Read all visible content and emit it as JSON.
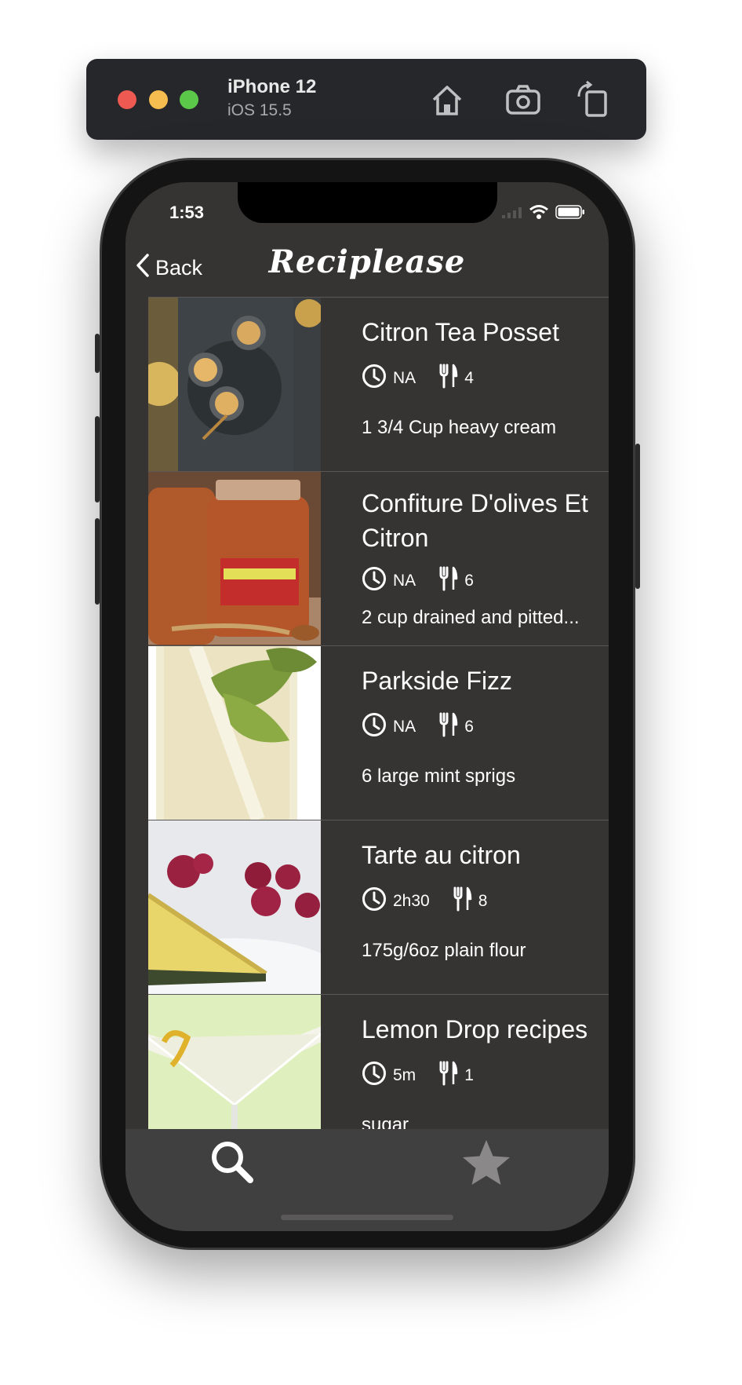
{
  "simulator": {
    "device_name": "iPhone 12",
    "os_version": "iOS 15.5",
    "tools": [
      "home-icon",
      "screenshot-icon",
      "rotate-icon"
    ]
  },
  "status_bar": {
    "time": "1:53",
    "icons": [
      "signal-icon",
      "wifi-icon",
      "battery-icon"
    ]
  },
  "nav": {
    "back_label": "Back",
    "title": "Reciplease"
  },
  "recipes": [
    {
      "title": "Citron Tea Posset",
      "time": "NA",
      "servings": "4",
      "ingredient": "1 3/4 Cup heavy cream"
    },
    {
      "title": "Confiture D'olives Et Citron",
      "time": "NA",
      "servings": "6",
      "ingredient": "2 cup drained and pitted..."
    },
    {
      "title": "Parkside Fizz",
      "time": "NA",
      "servings": "6",
      "ingredient": "6 large mint sprigs"
    },
    {
      "title": "Tarte au citron",
      "time": "2h30",
      "servings": "8",
      "ingredient": "175g/6oz plain flour"
    },
    {
      "title": "Lemon Drop recipes",
      "time": "5m",
      "servings": "1",
      "ingredient": "sugar"
    }
  ],
  "tabbar": {
    "tabs": [
      {
        "icon": "search-icon",
        "selected": true
      },
      {
        "icon": "star-icon",
        "selected": false
      }
    ]
  },
  "colors": {
    "screen_bg": "#363333",
    "tabbar_bg": "#414040",
    "tab_selected": "#ffffff",
    "tab_unselected": "#8a8888"
  }
}
